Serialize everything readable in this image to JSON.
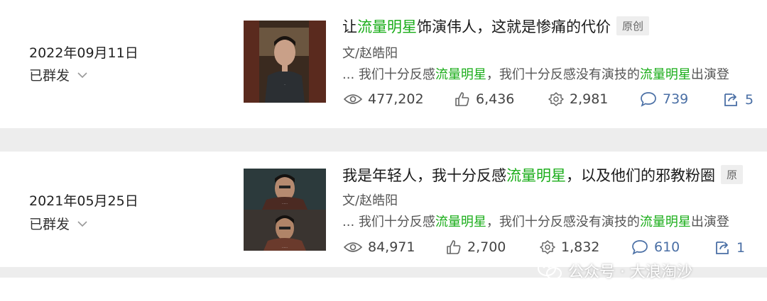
{
  "articles": [
    {
      "date": "2022年09月11日",
      "status": "已群发",
      "title_parts": {
        "pre": "让",
        "hl": "流量明星",
        "post": "饰演伟人，这就是惨痛的代价"
      },
      "badge": "原创",
      "author": "文/赵皓阳",
      "digest_parts": {
        "a": "... 我们十分反感",
        "b": "流量明星",
        "c": "，我们十分反感没有演技的",
        "d": "流量明星",
        "e": "出演登"
      },
      "stats": {
        "views": "477,202",
        "likes": "6,436",
        "shares": "2,981",
        "comments": "739",
        "forwards": "5"
      }
    },
    {
      "date": "2021年05月25日",
      "status": "已群发",
      "title_parts": {
        "pre": "我是年轻人，我十分反感",
        "hl": "流量明星",
        "post": "，以及他们的邪教粉圈"
      },
      "badge": "原",
      "author": "文/赵皓阳",
      "digest_parts": {
        "a": "... 我们十分反感",
        "b": "流量明星",
        "c": "，我们十分反感没有演技的",
        "d": "流量明星",
        "e": "出演登"
      },
      "stats": {
        "views": "84,971",
        "likes": "2,700",
        "shares": "1,832",
        "comments": "610",
        "forwards": "1"
      }
    }
  ],
  "watermark": "公众号 · 大浪淘沙",
  "icons": [
    "chevron-down-icon",
    "eye-icon",
    "thumbs-up-icon",
    "share-flower-icon",
    "comment-icon",
    "forward-icon",
    "wechat-icon"
  ],
  "colors": {
    "highlight": "#1aad19",
    "stat_blue": "#4a6fa5"
  }
}
